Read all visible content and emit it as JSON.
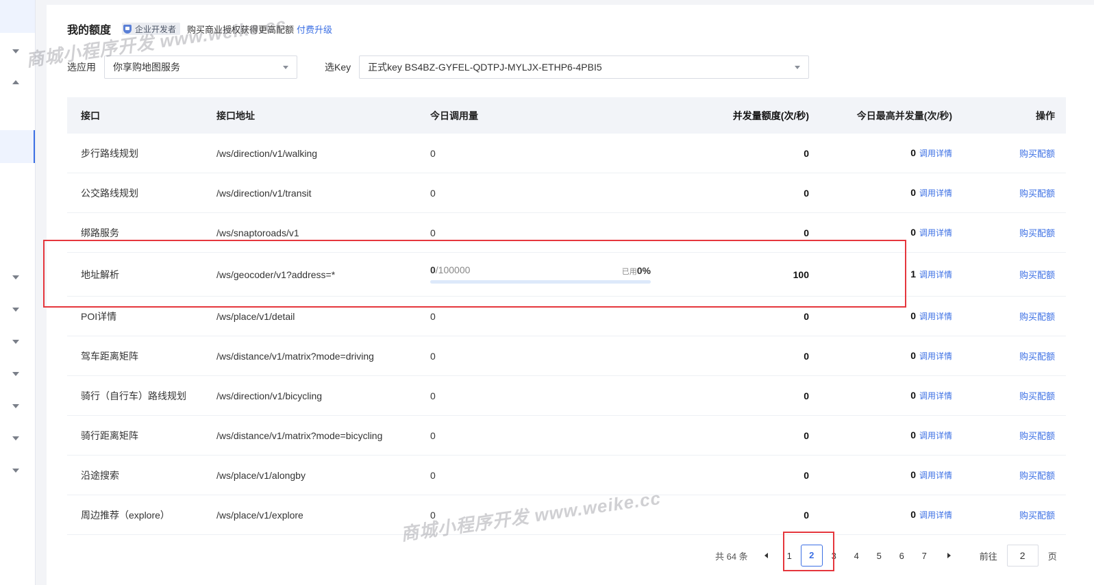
{
  "header": {
    "title": "我的额度",
    "badge": "企业开发者",
    "promo": "购买商业授权获得更高配额",
    "upgrade_link": "付费升级"
  },
  "filters": {
    "app_label": "选应用",
    "app_value": "你享购地图服务",
    "key_label": "选Key",
    "key_value": "正式key BS4BZ-GYFEL-QDTPJ-MYLJX-ETHP6-4PBI5"
  },
  "table": {
    "columns": [
      "接口",
      "接口地址",
      "今日调用量",
      "并发量额度(次/秒)",
      "今日最高并发量(次/秒)",
      "操作"
    ],
    "detail_label": "调用详情",
    "buy_label": "购买配额",
    "rows": [
      {
        "name": "步行路线规划",
        "url": "/ws/direction/v1/walking",
        "today": "0",
        "quota": "0",
        "max": "0"
      },
      {
        "name": "公交路线规划",
        "url": "/ws/direction/v1/transit",
        "today": "0",
        "quota": "0",
        "max": "0"
      },
      {
        "name": "绑路服务",
        "url": "/ws/snaptoroads/v1",
        "today": "0",
        "quota": "0",
        "max": "0"
      },
      {
        "name": "地址解析",
        "url": "/ws/geocoder/v1?address=*",
        "today_used": "0",
        "today_limit": "/100000",
        "used_pct_label": "已用",
        "used_pct": "0%",
        "used_fraction": 0,
        "quota": "100",
        "max": "1"
      },
      {
        "name": "POI详情",
        "url": "/ws/place/v1/detail",
        "today": "0",
        "quota": "0",
        "max": "0"
      },
      {
        "name": "驾车距离矩阵",
        "url": "/ws/distance/v1/matrix?mode=driving",
        "today": "0",
        "quota": "0",
        "max": "0"
      },
      {
        "name": "骑行（自行车）路线规划",
        "url": "/ws/direction/v1/bicycling",
        "today": "0",
        "quota": "0",
        "max": "0"
      },
      {
        "name": "骑行距离矩阵",
        "url": "/ws/distance/v1/matrix?mode=bicycling",
        "today": "0",
        "quota": "0",
        "max": "0"
      },
      {
        "name": "沿途搜索",
        "url": "/ws/place/v1/alongby",
        "today": "0",
        "quota": "0",
        "max": "0"
      },
      {
        "name": "周边推荐（explore）",
        "url": "/ws/place/v1/explore",
        "today": "0",
        "quota": "0",
        "max": "0"
      }
    ]
  },
  "pagination": {
    "total": "共 64 条",
    "pages": [
      "1",
      "2",
      "3",
      "4",
      "5",
      "6",
      "7"
    ],
    "current": "2",
    "goto_label": "前往",
    "goto_value": "2",
    "goto_unit": "页"
  },
  "watermark": "商城小程序开发 www.weike.cc",
  "colors": {
    "accent": "#3b6fe4",
    "highlight_border": "#e5363c",
    "header_bg": "#f2f4f8"
  }
}
